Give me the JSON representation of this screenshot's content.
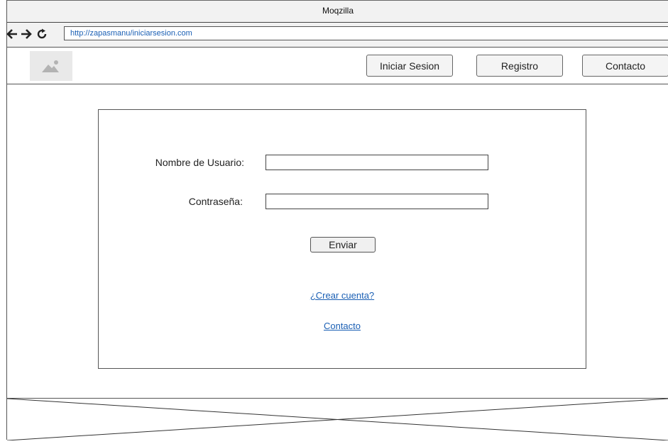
{
  "window": {
    "title": "Moqzilla"
  },
  "browser": {
    "url": "http://zapasmanu/iniciarsesion.com",
    "icons": [
      "back-arrow-icon",
      "forward-arrow-icon",
      "reload-icon"
    ]
  },
  "header": {
    "logo_icon": "image-placeholder-icon",
    "nav": {
      "login_label": "Iniciar Sesion",
      "register_label": "Registro",
      "contact_label": "Contacto"
    }
  },
  "login_form": {
    "username_label": "Nombre de Usuario:",
    "username_value": "",
    "password_label": "Contraseña:",
    "password_value": "",
    "submit_label": "Enviar",
    "create_account_link": "¿Crear cuenta?",
    "contact_link": "Contacto"
  },
  "footer": {
    "type": "placeholder-crossed-box"
  },
  "colors": {
    "link": "#1a5fb4",
    "border": "#555555",
    "chrome_bg": "#f2f2f2"
  }
}
